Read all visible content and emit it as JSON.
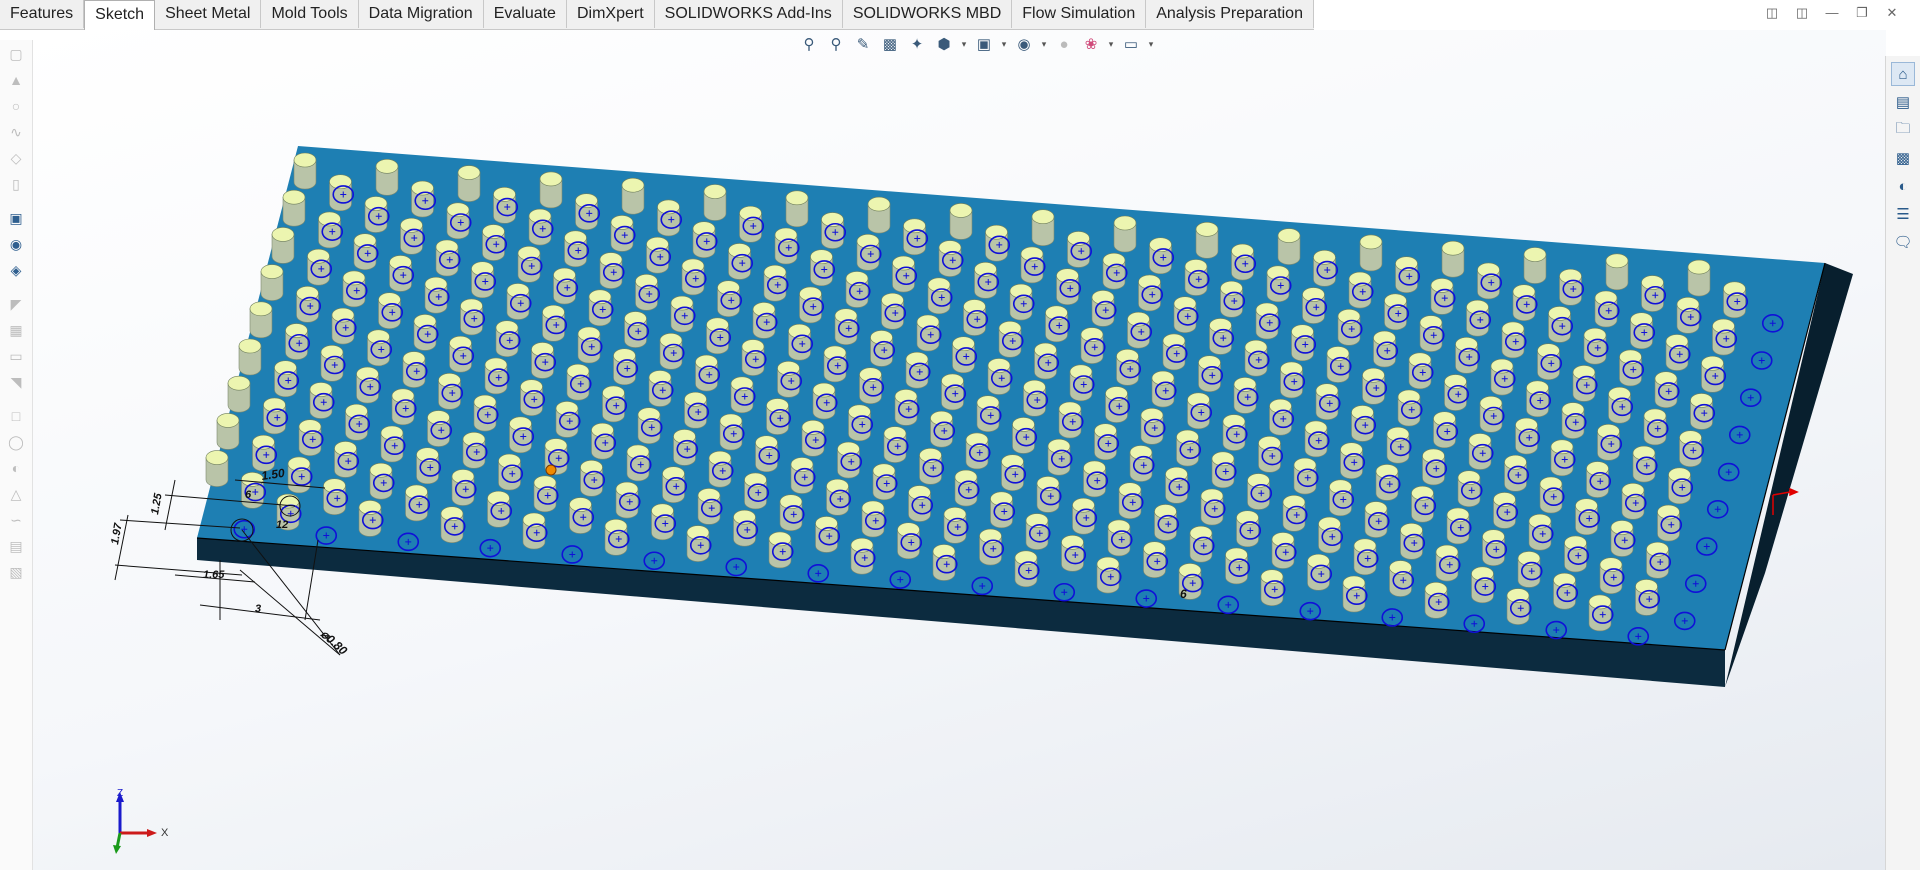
{
  "command_manager": {
    "tabs": [
      {
        "label": "Features",
        "active": false
      },
      {
        "label": "Sketch",
        "active": true
      },
      {
        "label": "Sheet Metal",
        "active": false
      },
      {
        "label": "Mold Tools",
        "active": false
      },
      {
        "label": "Data Migration",
        "active": false
      },
      {
        "label": "Evaluate",
        "active": false
      },
      {
        "label": "DimXpert",
        "active": false
      },
      {
        "label": "SOLIDWORKS Add-Ins",
        "active": false
      },
      {
        "label": "SOLIDWORKS MBD",
        "active": false
      },
      {
        "label": "Flow Simulation",
        "active": false
      },
      {
        "label": "Analysis Preparation",
        "active": false
      }
    ]
  },
  "window_controls": [
    "tile-left-icon",
    "tile-right-icon",
    "minimize-icon",
    "restore-icon",
    "close-icon"
  ],
  "headsup_toolbar": [
    "zoom-to-fit-icon",
    "zoom-to-area-icon",
    "previous-view-icon",
    "section-view-icon",
    "dynamic-annotation-icon",
    "view-orientation-icon",
    "display-style-icon",
    "hide-show-items-icon",
    "edit-appearance-icon",
    "apply-scene-icon",
    "view-settings-icon"
  ],
  "task_pane": [
    "solidworks-resources-icon",
    "design-library-icon",
    "file-explorer-icon",
    "view-palette-icon",
    "appearances-scenes-icon",
    "custom-properties-icon",
    "forum-icon"
  ],
  "colors": {
    "plate_top": "#1e7fb3",
    "plate_front": "#0c2b3f",
    "plate_side": "#081f2e",
    "pin_top": "#ecf5b0",
    "pin_body": "#b9c4a8",
    "sketch_circle": "#1010d8",
    "selection_point": "#f08a00"
  },
  "dimensions": {
    "d1": "1.50",
    "d2": "6",
    "d3": "1.25",
    "d4": "12",
    "d5": "1.97",
    "d6": "1.65",
    "d7": "3",
    "d8": "⌀0.80",
    "d9": "6"
  },
  "triad": {
    "z": "Z",
    "x": "X"
  }
}
